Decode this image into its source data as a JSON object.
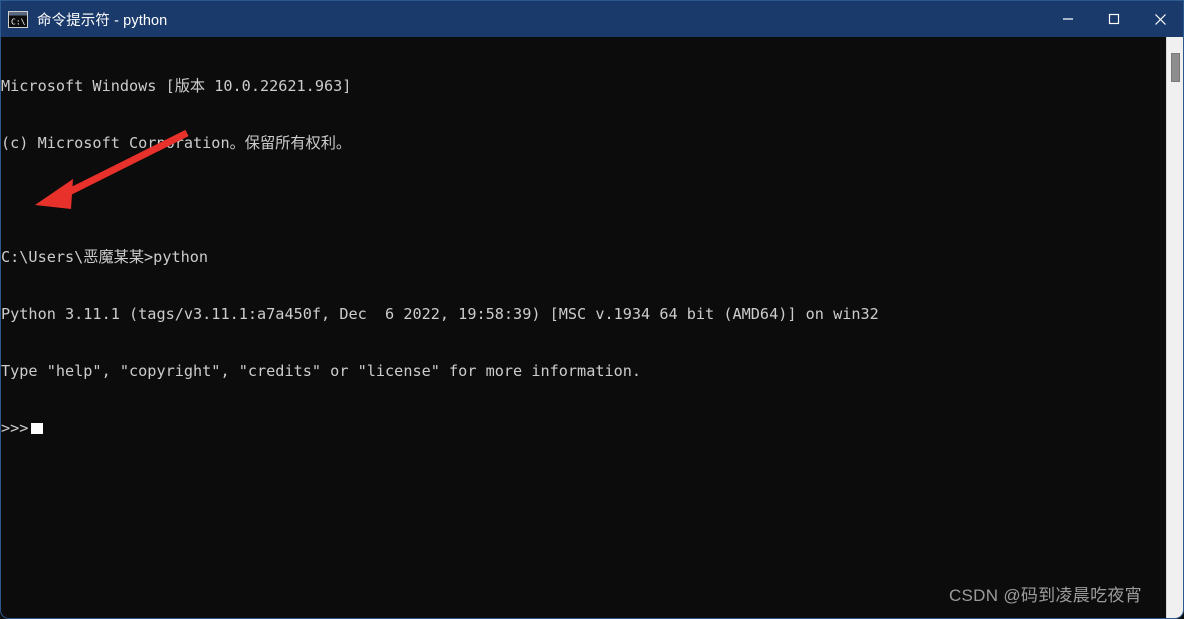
{
  "window": {
    "title": "命令提示符 - python",
    "icon": "command-prompt-icon",
    "accent_color": "#1a3a6b",
    "background_color": "#0c0c0c",
    "text_color": "#cccccc",
    "controls": {
      "minimize_label": "最小化",
      "maximize_label": "最大化",
      "close_label": "关闭"
    }
  },
  "terminal": {
    "lines": [
      "Microsoft Windows [版本 10.0.22621.963]",
      "(c) Microsoft Corporation。保留所有权利。",
      "",
      "C:\\Users\\恶魔某某>python",
      "Python 3.11.1 (tags/v3.11.1:a7a450f, Dec  6 2022, 19:58:39) [MSC v.1934 64 bit (AMD64)] on win32",
      "Type \"help\", \"copyright\", \"credits\" or \"license\" for more information.",
      ">>>"
    ],
    "prompt": ">>>",
    "cursor_visible": true,
    "cursor_color": "#ffffff"
  },
  "scrollbar": {
    "track_color": "#f0f0f0",
    "thumb_color": "#8d8d8d",
    "thumb_position_percent": 4
  },
  "annotation": {
    "arrow_color": "#e8312a",
    "points_to": ">>> prompt cursor"
  },
  "watermark": {
    "text": "CSDN @码到凌晨吃夜宵"
  }
}
